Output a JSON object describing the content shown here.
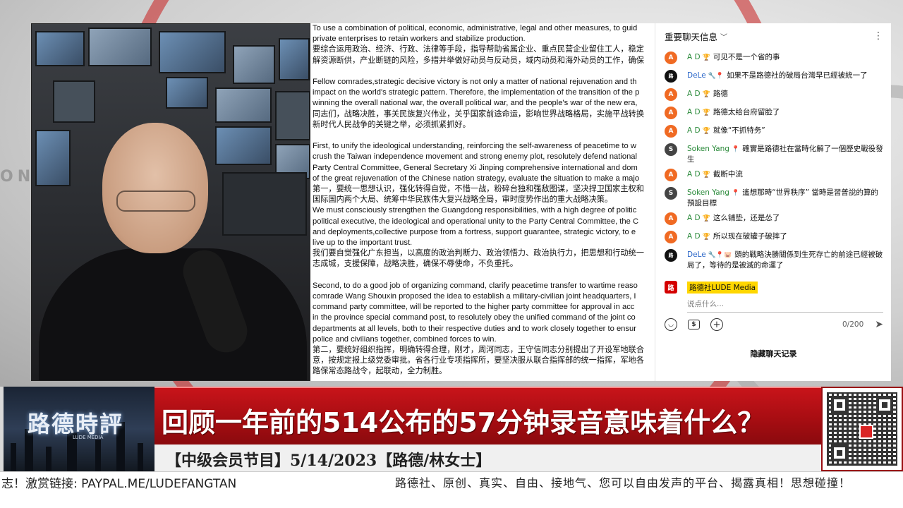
{
  "backdrop": {
    "side_word": "ON"
  },
  "document": {
    "lines": [
      "To use a combination of political, economic, administrative, legal and other measures, to guid",
      "private enterprises to retain workers and stabilize production.",
      "要综合运用政治、经济、行政、法律等手段，指导帮助省属企业、重点民营企业留住工人，稳定",
      "解资源断供，产业断链的风险，多措并举做好动员与反动员，域内动员和海外动员的工作，确保",
      "",
      "Fellow comrades,strategic decisive victory is not only a matter of national rejuvenation and th",
      "impact on the world's strategic pattern. Therefore, the implementation of the transition of the p",
      "winning the overall national war, the overall political war, and the people's war of the new era,",
      "同志们，战略决胜，事关民族复兴伟业，关乎国家前途命运，影响世界战略格局，实施平战转换",
      "新时代人民战争的关键之举，必须抓紧抓好。",
      "",
      "First, to unify the ideological understanding, reinforcing the self-awareness of peacetime to w",
      "crush the Taiwan independence movement and strong enemy plot, resolutely defend national",
      "Party Central Committee, General Secretary Xi Jinping comprehensive international and dom",
      "of the great rejuvenation of the Chinese nation strategy, evaluate the situation to make a majo",
      "第一，要统一思想认识，强化转得自觉，不惜一战，粉碎台独和强敌图谋，坚决捍卫国家主权和",
      "国际国内两个大局、统筹中华民族伟大复兴战略全局，审时度势作出的重大战略决策。",
      "We must consciously strengthen the Guangdong responsibilities, with a high degree of politic",
      "political executive, the ideological and operational unity to the Party Central Committee, the C",
      "and deployments,collective purpose from a fortress, support guarantee, strategic victory, to e",
      "live up to the important trust.",
      "我们要自觉强化广东担当，以高度的政治判断力、政治领悟力、政治执行力，把思想和行动统一",
      "志成城，支援保障，战略决胜，确保不辱使命，不负重托。",
      "",
      "Second, to do a good job of organizing command, clarify peacetime transfer to wartime reaso",
      "comrade Wang Shouxin proposed the idea to establish a military-civilian joint headquarters, I",
      "command party committee, will be reported to the higher party committee for approval in acc",
      "in the province special command post, to resolutely obey the unified command of the joint co",
      "departments at all levels, both to their respective duties and to work closely together to ensur",
      "police and civilians together, combined forces to win.",
      "第二，要统好组织指挥，明确转得合理，刚才，周河同志，王守信同志分别提出了开设军地联合",
      "意，按规定报上级党委审批。省各行业专项指挥所，要坚决服从联合指挥部的统一指挥，军地各",
      "路保常态路战令，起联动，全力制胜。"
    ]
  },
  "chat": {
    "header_title": "重要聊天信息",
    "messages": [
      {
        "initial": "A",
        "author": "A D",
        "badge": "🏆",
        "text": "可见不是一个省的事"
      },
      {
        "initial": "路",
        "author": "DeLe",
        "badge": "🔧📍",
        "text": "如果不是路德社的破局台灣早已經被統一了"
      },
      {
        "initial": "A",
        "author": "A D",
        "badge": "🏆",
        "text": "路德"
      },
      {
        "initial": "A",
        "author": "A D",
        "badge": "🏆",
        "text": "路德太给台府留脸了"
      },
      {
        "initial": "A",
        "author": "A D",
        "badge": "🏆",
        "text": "就像“不抓特务”"
      },
      {
        "initial": "S",
        "author": "Soken Yang",
        "badge": "📍",
        "text": "確實是路德社在當時化解了一個歷史戰役發生"
      },
      {
        "initial": "A",
        "author": "A D",
        "badge": "🏆",
        "text": "截断中流"
      },
      {
        "initial": "S",
        "author": "Soken Yang",
        "badge": "📍",
        "text": "遙想那時“世界秩序” 當時是習普說的算的預設目標"
      },
      {
        "initial": "A",
        "author": "A D",
        "badge": "🏆",
        "text": "这么铺垫，还是怂了"
      },
      {
        "initial": "A",
        "author": "A D",
        "badge": "🏆",
        "text": "所以现在破罐子破摔了"
      },
      {
        "initial": "路",
        "author": "DeLe",
        "badge": "🔧📍🐷",
        "text": "頭的戰略決勝關係到生死存亡的前途已經被破局了，等待的是被滅的命運了"
      }
    ],
    "composer": {
      "avatar_initial": "路",
      "user_name": "路德社LUDE Media",
      "placeholder": "说点什么...",
      "counter": "0/200"
    },
    "hide_label": "隐藏聊天记录"
  },
  "lower_third": {
    "logo_text": "路德時評",
    "logo_sub": "LUDE MEDIA",
    "headline": "回顾一年前的514公布的57分钟录音意味着什么？",
    "subline": "【中级会员节目】5/14/2023【路德/林女士】"
  },
  "ticker": {
    "left": "志！激赏链接: PAYPAL.ME/LUDEFANGTAN",
    "right": "路德社、原创、真实、自由、接地气、您可以自由发声的平台、揭露真相！思想碰撞！"
  }
}
